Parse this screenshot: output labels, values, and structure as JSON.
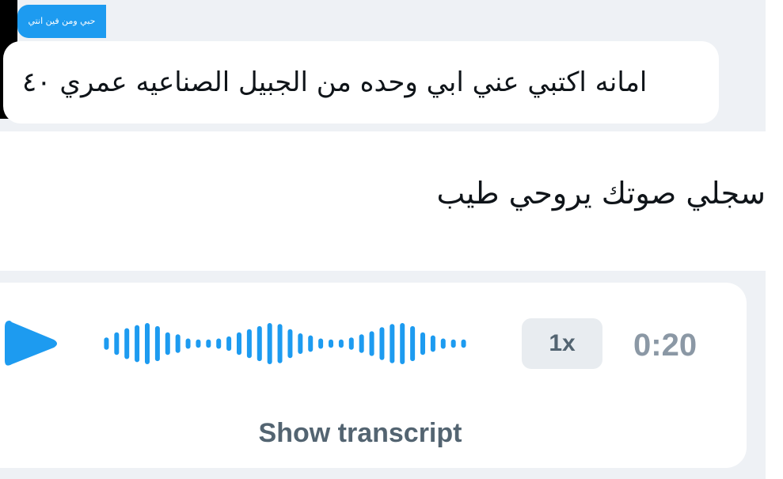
{
  "quoted_reply": {
    "chip_text": "حبي ومن فين انتي",
    "text": "امانه اكتبي عني ابي وحده من الجبيل الصناعيه عمري ٤٠"
  },
  "message": {
    "text": "سجلي صوتك يروحي طيب"
  },
  "voice_message": {
    "play_icon": "play-icon",
    "playback_speed": "1x",
    "duration": "0:20",
    "show_transcript_label": "Show transcript",
    "accent_color": "#1d9bf0",
    "waveform_levels": [
      0.3,
      0.55,
      0.75,
      0.9,
      1.0,
      0.85,
      0.55,
      0.45,
      0.25,
      0.2,
      0.2,
      0.25,
      0.35,
      0.55,
      0.7,
      0.85,
      1.0,
      0.95,
      0.7,
      0.5,
      0.4,
      0.25,
      0.2,
      0.2,
      0.3,
      0.45,
      0.6,
      0.8,
      0.95,
      1.0,
      0.85,
      0.55,
      0.4,
      0.25,
      0.2,
      0.2
    ]
  },
  "colors": {
    "background_band": "#eef1f5",
    "text_primary": "#0f1419",
    "text_secondary": "#536471",
    "duration_text": "#8b98a5"
  }
}
